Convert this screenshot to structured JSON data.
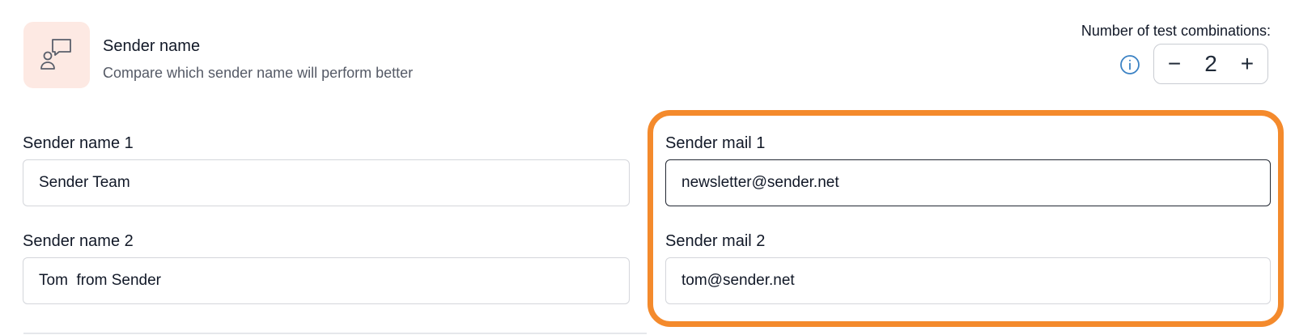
{
  "header": {
    "title": "Sender name",
    "description": "Compare which sender name will perform better",
    "icon": "person-chat-icon",
    "icon_bg_color": "#fde9e3"
  },
  "combinations": {
    "label": "Number of test combinations:",
    "value": "2",
    "decrement_label": "−",
    "increment_label": "+"
  },
  "sender_names": [
    {
      "label": "Sender name 1",
      "value": "Sender Team"
    },
    {
      "label": "Sender name 2",
      "value": "Tom  from Sender"
    }
  ],
  "sender_mails": [
    {
      "label": "Sender mail 1",
      "value": "newsletter@sender.net"
    },
    {
      "label": "Sender mail 2",
      "value": "tom@sender.net"
    }
  ],
  "colors": {
    "highlight": "#f48a2c",
    "info_icon": "#3b82c4"
  }
}
